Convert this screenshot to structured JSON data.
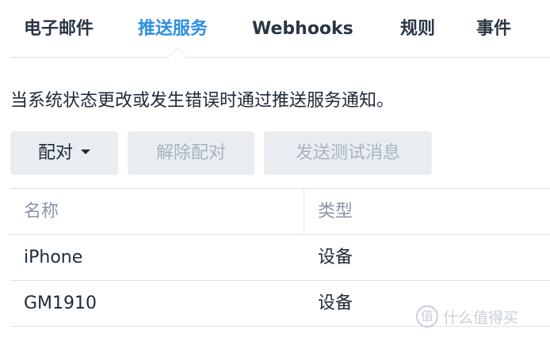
{
  "tabs": [
    {
      "label": "电子邮件",
      "active": false
    },
    {
      "label": "推送服务",
      "active": true
    },
    {
      "label": "Webhooks",
      "active": false
    },
    {
      "label": "规则",
      "active": false
    },
    {
      "label": "事件",
      "active": false
    }
  ],
  "description": "当系统状态更改或发生错误时通过推送服务通知。",
  "toolbar": {
    "pair_label": "配对",
    "unpair_label": "解除配对",
    "send_test_label": "发送测试消息"
  },
  "table": {
    "columns": [
      "名称",
      "类型"
    ],
    "rows": [
      [
        "iPhone",
        "设备"
      ],
      [
        "GM1910",
        "设备"
      ]
    ]
  },
  "watermark": {
    "badge": "值",
    "text": "什么值得买"
  },
  "colors": {
    "accent": "#2d8fe3",
    "text": "#1e2a36",
    "muted": "#8a96a3",
    "disabled_text": "#a8b3be",
    "button_bg": "#e9edf1",
    "divider": "#dde2e8"
  },
  "icons": {
    "pair_dropdown": "caret-down-icon",
    "active_tab_pointer": "tab-pointer-icon"
  }
}
